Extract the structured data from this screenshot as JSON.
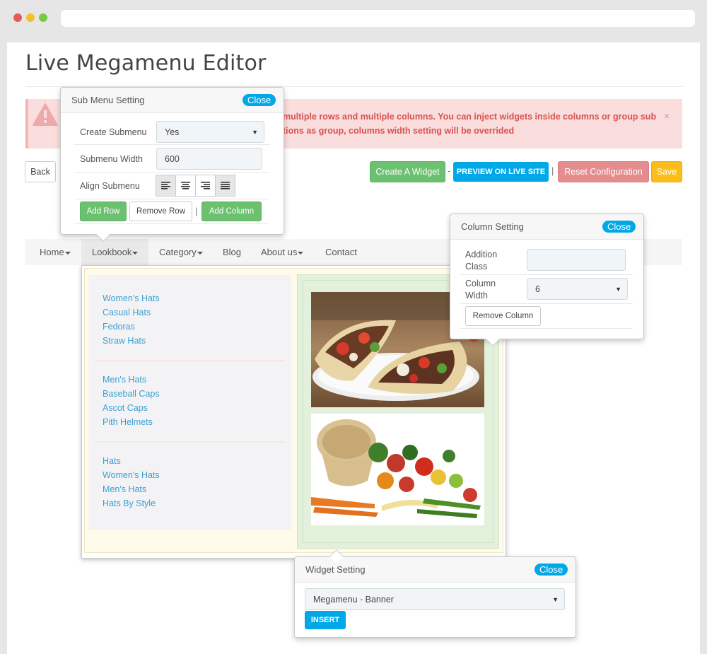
{
  "page": {
    "title": "Live Megamenu Editor"
  },
  "alert": {
    "line1": "multiple rows and multiple columns. You can inject widgets inside columns or group sub",
    "line2": "tions as group, columns width setting will be overrided",
    "close": "×"
  },
  "toolbar": {
    "back": "Back",
    "create_widget": "Create A Widget",
    "dash": "-",
    "preview": "PREVIEW ON LIVE SITE",
    "pipe": "|",
    "reset": "Reset Configuration",
    "save": "Save"
  },
  "nav": {
    "items": [
      {
        "label": "Home",
        "caret": true
      },
      {
        "label": "Lookbook",
        "caret": true
      },
      {
        "label": "Category",
        "caret": true
      },
      {
        "label": "Blog",
        "caret": false
      },
      {
        "label": "About us",
        "caret": true
      },
      {
        "label": "Contact",
        "caret": false
      }
    ]
  },
  "submenu_links": {
    "group1": [
      "Women's Hats",
      "Casual Hats",
      "Fedoras",
      "Straw Hats"
    ],
    "group2": [
      "Men's Hats",
      "Baseball Caps",
      "Ascot Caps",
      "Pith Helmets"
    ],
    "group3": [
      "Hats",
      "Women's Hats",
      "Men's Hats",
      "Hats By Style"
    ]
  },
  "sub_menu_setting": {
    "title": "Sub Menu Setting",
    "close": "Close",
    "create_submenu_label": "Create Submenu",
    "create_submenu_value": "Yes",
    "width_label": "Submenu Width",
    "width_value": "600",
    "align_label": "Align Submenu",
    "add_row": "Add Row",
    "remove_row": "Remove Row",
    "pipe": "|",
    "add_column": "Add Column"
  },
  "column_setting": {
    "title": "Column Setting",
    "close": "Close",
    "class_label_1": "Addition",
    "class_label_2": "Class",
    "class_value": "",
    "width_label_1": "Column",
    "width_label_2": "Width",
    "width_value": "6",
    "remove_column": "Remove Column"
  },
  "widget_setting": {
    "title": "Widget Setting",
    "close": "Close",
    "widget_value": "Megamenu - Banner",
    "insert": "INSERT"
  },
  "colors": {
    "accent_blue": "#00a8e8",
    "green": "#6bc16f",
    "red": "#e48c8e",
    "yellow": "#fbbd19",
    "link": "#3b9fd4"
  }
}
